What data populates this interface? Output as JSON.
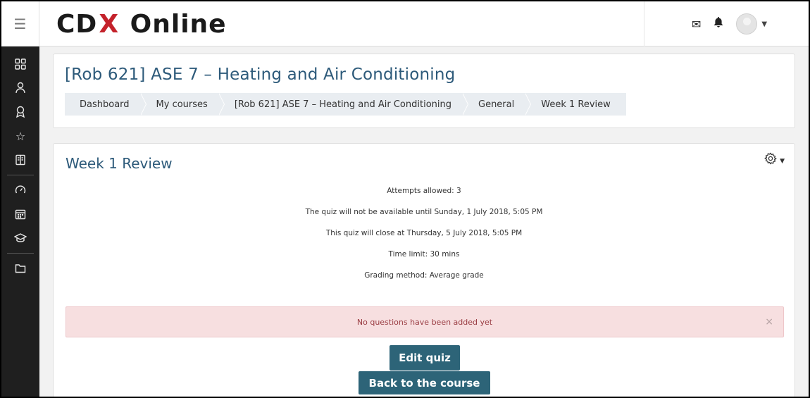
{
  "header": {
    "logo_left": "CD",
    "logo_x": "X",
    "logo_right": "Online",
    "menu_icon": "hamburger-icon",
    "icons": [
      "envelope-icon",
      "bell-icon",
      "avatar",
      "chevron-down-icon"
    ]
  },
  "sidebar": {
    "items": [
      {
        "icon": "dashboard-grid-icon"
      },
      {
        "icon": "user-badge-icon"
      },
      {
        "icon": "award-icon"
      },
      {
        "icon": "star-icon"
      },
      {
        "icon": "book-icon"
      },
      {
        "icon": "speedometer-icon"
      },
      {
        "icon": "calendar-icon"
      },
      {
        "icon": "graduation-cap-icon"
      },
      {
        "icon": "folder-icon"
      }
    ]
  },
  "course": {
    "title": "[Rob 621] ASE 7 – Heating and Air Conditioning",
    "breadcrumb": [
      "Dashboard",
      "My courses",
      "[Rob 621] ASE 7 – Heating and Air Conditioning",
      "General",
      "Week 1 Review"
    ]
  },
  "quiz": {
    "title": "Week 1 Review",
    "info": [
      "Attempts allowed: 3",
      "The quiz will not be available until Sunday, 1 July 2018, 5:05 PM",
      "This quiz will close at Thursday, 5 July 2018, 5:05 PM",
      "Time limit: 30 mins",
      "Grading method: Average grade"
    ],
    "alert": "No questions have been added yet",
    "alert_close": "×",
    "edit_button": "Edit quiz",
    "back_button": "Back to the course"
  },
  "colors": {
    "sidebar_bg": "#1f1f1f",
    "title": "#2d5a7a",
    "button": "#2d6478",
    "alert_bg": "#f7dfe0",
    "logo_red": "#c4222b"
  }
}
